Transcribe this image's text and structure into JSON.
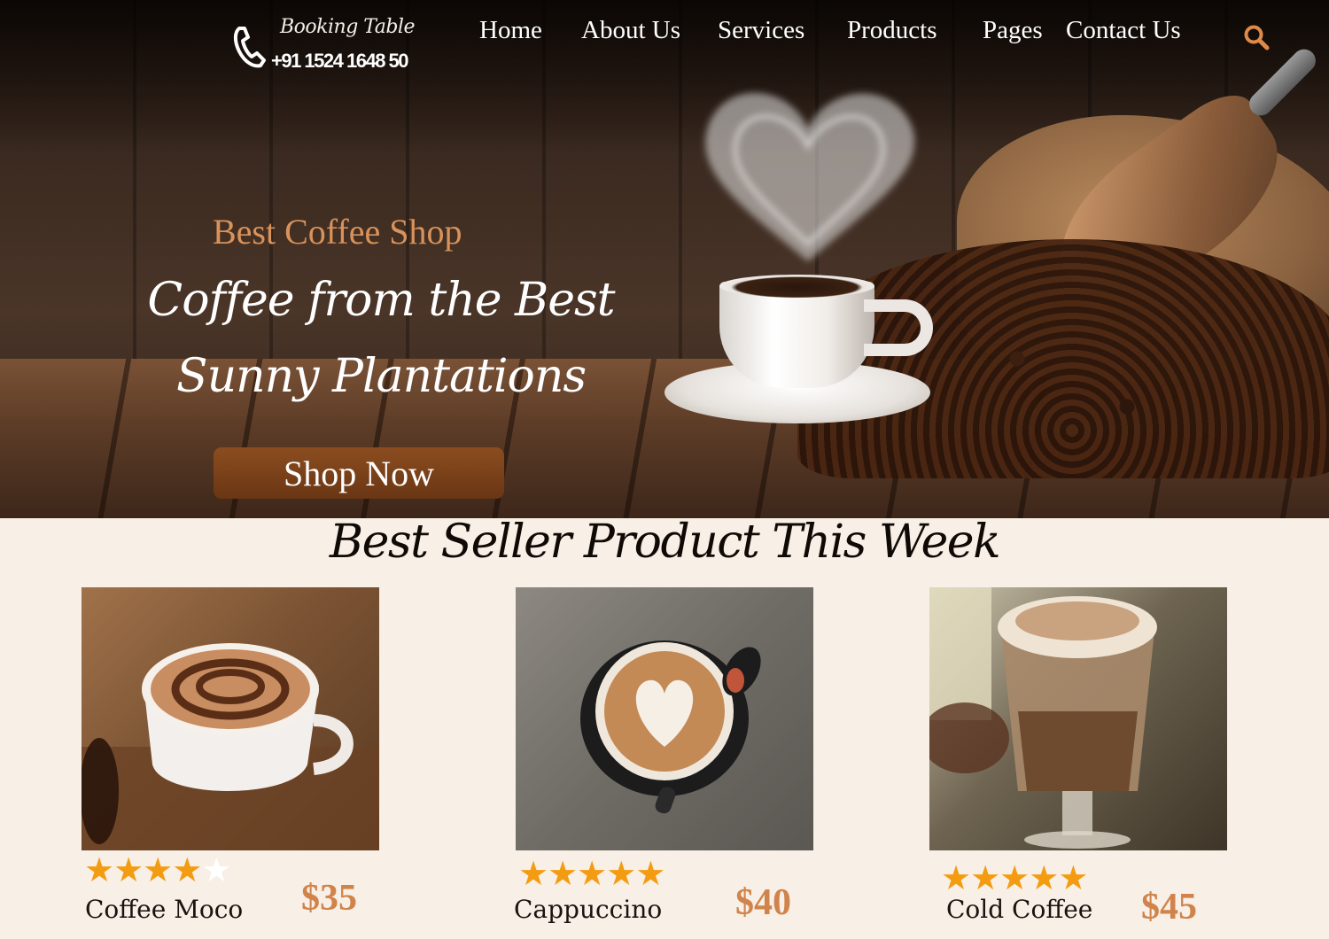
{
  "header": {
    "booking_label": "Booking Table",
    "booking_phone": "+91 1524 1648 50",
    "nav": [
      "Home",
      "About Us",
      "Services",
      "Products",
      "Pages",
      "Contact Us"
    ]
  },
  "hero": {
    "subtitle": "Best Coffee Shop",
    "title": "Coffee from the Best Sunny Plantations",
    "cta_label": "Shop Now"
  },
  "best_sellers": {
    "title": "Best Seller Product This Week",
    "products": [
      {
        "name": "Coffee Moco",
        "price": "$35",
        "rating": 4,
        "max_rating": 5
      },
      {
        "name": "Cappuccino",
        "price": "$40",
        "rating": 5,
        "max_rating": 5
      },
      {
        "name": "Cold Coffee",
        "price": "$45",
        "rating": 5,
        "max_rating": 5
      }
    ]
  },
  "colors": {
    "accent": "#d9925a",
    "button": "#7a4119",
    "star": "#f39c12",
    "price": "#d0844b",
    "section_bg": "#f8efe6"
  },
  "icons": [
    "phone-icon",
    "search-icon",
    "star-icon"
  ]
}
